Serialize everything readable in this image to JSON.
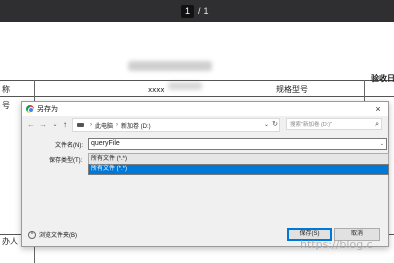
{
  "viewer": {
    "current_page": "1",
    "page_separator": "/",
    "total_pages": "1"
  },
  "document": {
    "cell_xxxx": "xxxx",
    "cell_spec_model": "规格型号",
    "cell_inspection": "验收日",
    "cell_left_top": "称",
    "cell_left_mid": "号",
    "cell_left_bottom": "办人"
  },
  "dialog": {
    "title": "另存为",
    "close_symbol": "×",
    "nav": {
      "back_symbol": "←",
      "forward_symbol": "→",
      "dropdown_symbol": "⌄",
      "up_symbol": "↑"
    },
    "breadcrumb": [
      "此电脑",
      "新加卷 (D:)"
    ],
    "breadcrumb_separator": "›",
    "address_dropdown_symbol": "⌄",
    "refresh_symbol": "↻",
    "search_placeholder": "搜索\"新加卷 (D:)\"",
    "filename_label": "文件名(N):",
    "filename_value": "queryFile",
    "filetype_label": "保存类型(T):",
    "filetype_value": "所有文件 (*.*)",
    "dropdown_options": [
      "所有文件 (*.*)"
    ],
    "browse_toggle_label": "浏览文件夹(B)",
    "save_button": "保存(S)",
    "cancel_button": "取消"
  },
  "watermark": "https://blog.c"
}
